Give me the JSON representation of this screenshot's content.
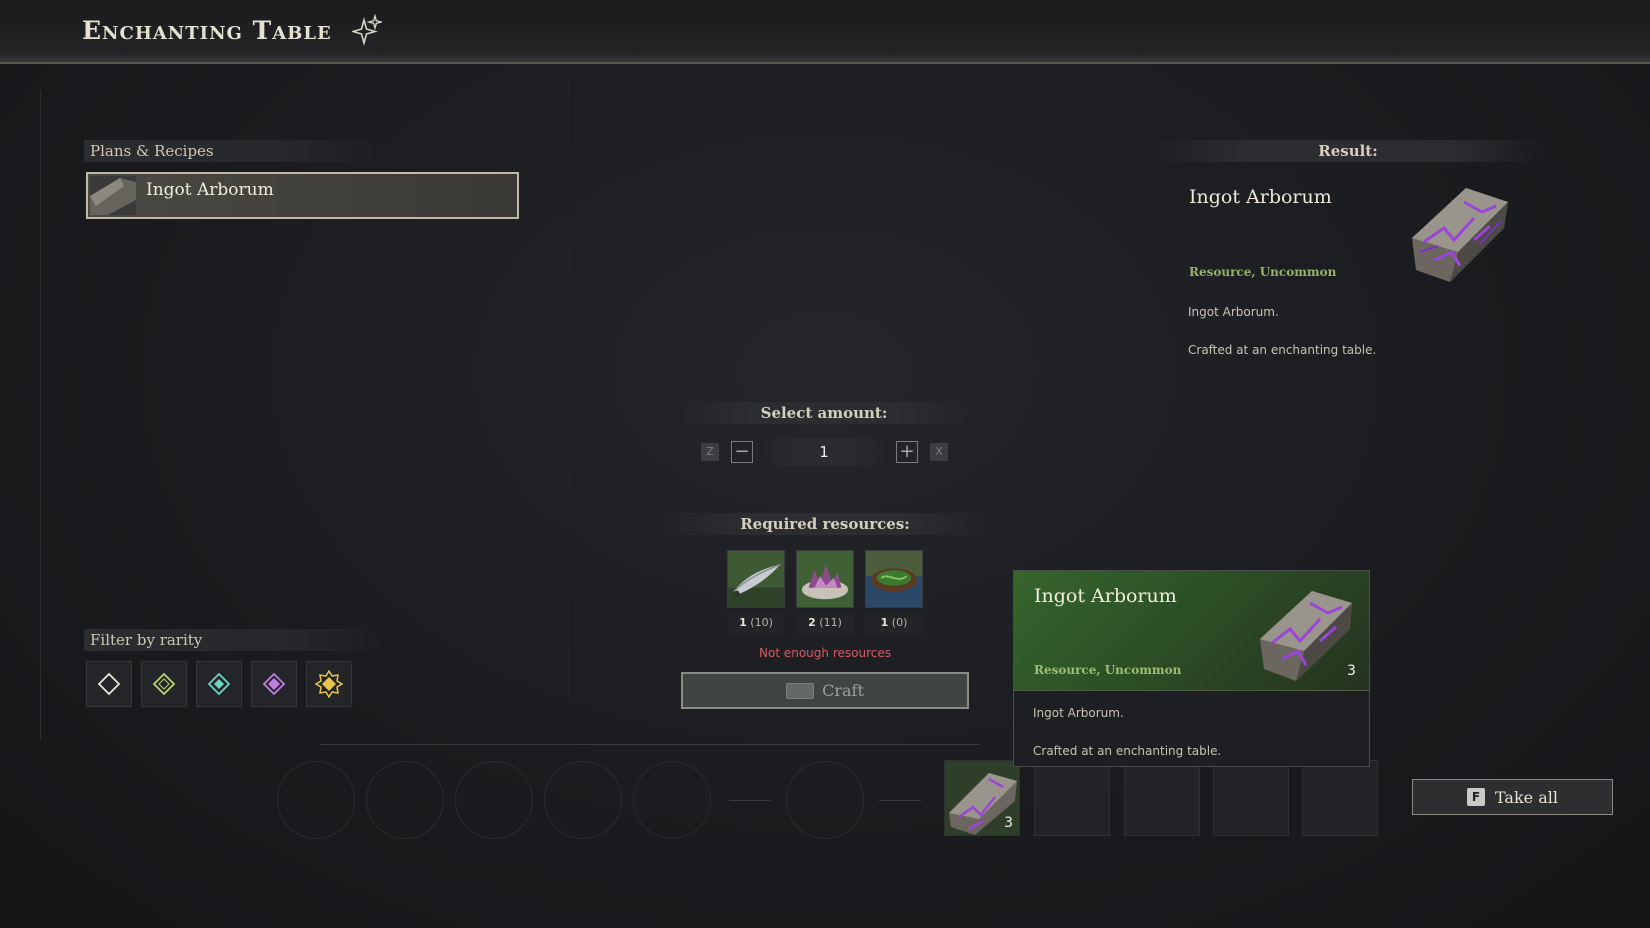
{
  "header": {
    "title": "Enchanting Table",
    "icon": "sparkle-icon"
  },
  "plans": {
    "heading": "Plans & Recipes",
    "items": [
      {
        "label": "Ingot Arborum",
        "selected": true
      }
    ]
  },
  "filter": {
    "heading": "Filter by rarity",
    "rarities": [
      {
        "name": "common",
        "color": "#e8e4d6"
      },
      {
        "name": "uncommon",
        "color": "#b9d56a"
      },
      {
        "name": "rare",
        "color": "#6fd3c4"
      },
      {
        "name": "epic",
        "color": "#c27ce6"
      },
      {
        "name": "legendary",
        "color": "#e6c44c"
      }
    ]
  },
  "amount": {
    "heading": "Select amount:",
    "value": "1",
    "decrease_key": "Z",
    "increase_key": "X",
    "minus": "−",
    "plus": "+"
  },
  "resources": {
    "heading": "Required resources:",
    "items": [
      {
        "icon": "blade-icon",
        "required": "1",
        "owned": "(10)"
      },
      {
        "icon": "purple-crystal-bowl-icon",
        "required": "2",
        "owned": "(11)"
      },
      {
        "icon": "green-essence-bowl-icon",
        "required": "1",
        "owned": "(0)"
      }
    ],
    "warning": "Not enough resources"
  },
  "craft": {
    "label": "Craft",
    "enabled": false
  },
  "result": {
    "heading": "Result:",
    "name": "Ingot Arborum",
    "type": "Resource, Uncommon",
    "description_1": "Ingot Arborum.",
    "description_2": "Crafted at an enchanting table."
  },
  "tooltip": {
    "name": "Ingot Arborum",
    "type": "Resource, Uncommon",
    "count": "3",
    "description_1": "Ingot Arborum.",
    "description_2": "Crafted at an enchanting table."
  },
  "output": {
    "count": "3"
  },
  "take_all": {
    "key": "F",
    "label": "Take all"
  },
  "colors": {
    "uncommon_green": "#95b36a",
    "warning_red": "#d65a66",
    "ingot_purple": "#8b3fc7"
  }
}
